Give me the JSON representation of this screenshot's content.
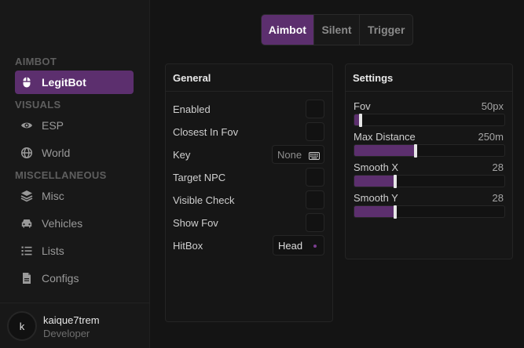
{
  "sidebar": {
    "sections": {
      "aimbot": "AIMBOT",
      "visuals": "VISUALS",
      "misc": "MISCELLANEOUS"
    },
    "items": [
      {
        "label": "LegitBot",
        "icon": "mouse-icon"
      },
      {
        "label": "ESP",
        "icon": "eye-icon"
      },
      {
        "label": "World",
        "icon": "globe-icon"
      },
      {
        "label": "Misc",
        "icon": "layers-icon"
      },
      {
        "label": "Vehicles",
        "icon": "car-icon"
      },
      {
        "label": "Lists",
        "icon": "list-icon"
      },
      {
        "label": "Configs",
        "icon": "file-icon"
      }
    ],
    "active_item": "LegitBot"
  },
  "user": {
    "initial": "k",
    "name": "kaique7trem",
    "role": "Developer"
  },
  "tabs": [
    {
      "label": "Aimbot",
      "active": true
    },
    {
      "label": "Silent",
      "active": false
    },
    {
      "label": "Trigger",
      "active": false
    }
  ],
  "general": {
    "title": "General",
    "enabled": "Enabled",
    "closest_in_fov": "Closest In Fov",
    "key": "Key",
    "key_value": "None",
    "target_npc": "Target NPC",
    "visible_check": "Visible Check",
    "show_fov": "Show Fov",
    "hitbox": "HitBox",
    "hitbox_value": "Head"
  },
  "settings": {
    "title": "Settings",
    "sliders": [
      {
        "label": "Fov",
        "value_text": "50px",
        "level": 0.04
      },
      {
        "label": "Max Distance",
        "value_text": "250m",
        "level": 0.41
      },
      {
        "label": "Smooth X",
        "value_text": "28",
        "level": 0.27
      },
      {
        "label": "Smooth Y",
        "value_text": "28",
        "level": 0.27
      }
    ]
  },
  "colors": {
    "accent": "#5c2f6e",
    "background": "#141414",
    "panel": "#161616"
  }
}
